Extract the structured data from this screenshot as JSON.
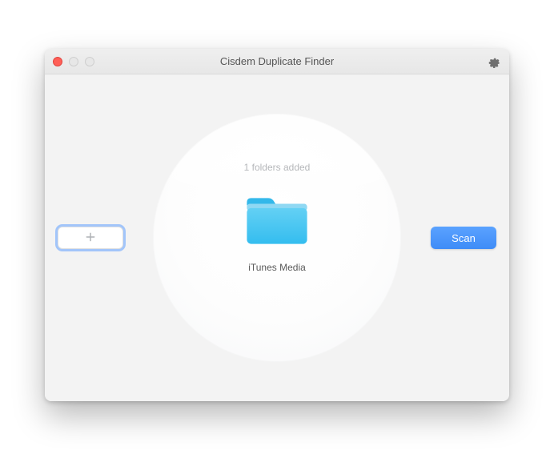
{
  "window": {
    "title": "Cisdem Duplicate Finder"
  },
  "status": {
    "folders_added_text": "1 folders added"
  },
  "folders": [
    {
      "label": "iTunes Media"
    }
  ],
  "buttons": {
    "scan_label": "Scan"
  },
  "icons": {
    "add": "plus-icon",
    "settings": "gear-icon",
    "folder": "folder-icon"
  },
  "colors": {
    "accent": "#3f8cf7",
    "folder": "#3fc3f0"
  }
}
